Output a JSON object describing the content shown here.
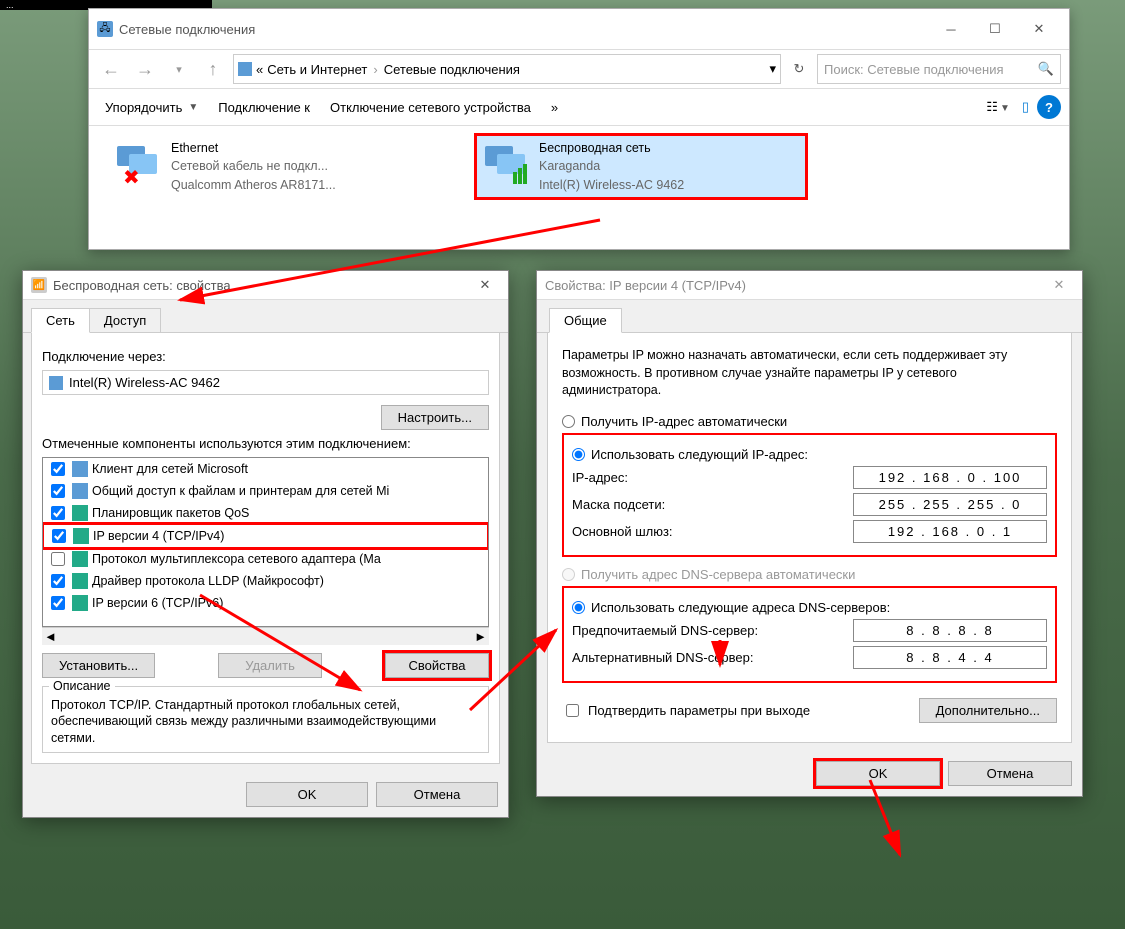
{
  "explorer": {
    "title": "Сетевые подключения",
    "breadcrumb": {
      "pre": "«",
      "a": "Сеть и Интернет",
      "b": "Сетевые подключения"
    },
    "search_placeholder": "Поиск: Сетевые подключения",
    "toolbar": {
      "organize": "Упорядочить",
      "connect": "Подключение к",
      "disable": "Отключение сетевого устройства",
      "more": "»"
    },
    "conns": [
      {
        "name": "Ethernet",
        "line2": "Сетевой кабель не подкл...",
        "line3": "Qualcomm Atheros AR8171..."
      },
      {
        "name": "Беспроводная сеть",
        "line2": "Karaganda",
        "line3": "Intel(R) Wireless-AC 9462"
      }
    ]
  },
  "props": {
    "title": "Беспроводная сеть: свойства",
    "tabs": {
      "net": "Сеть",
      "access": "Доступ"
    },
    "conn_via": "Подключение через:",
    "adapter": "Intel(R) Wireless-AC 9462",
    "configure": "Настроить...",
    "components_label": "Отмеченные компоненты используются этим подключением:",
    "items": [
      {
        "c": true,
        "t": "Клиент для сетей Microsoft"
      },
      {
        "c": true,
        "t": "Общий доступ к файлам и принтерам для сетей Mi"
      },
      {
        "c": true,
        "t": "Планировщик пакетов QoS"
      },
      {
        "c": true,
        "t": "IP версии 4 (TCP/IPv4)"
      },
      {
        "c": false,
        "t": "Протокол мультиплексора сетевого адаптера (Ма"
      },
      {
        "c": true,
        "t": "Драйвер протокола LLDP (Майкрософт)"
      },
      {
        "c": true,
        "t": "IP версии 6 (TCP/IPv6)"
      }
    ],
    "btn_install": "Установить...",
    "btn_remove": "Удалить",
    "btn_props": "Свойства",
    "desc_title": "Описание",
    "desc": "Протокол TCP/IP. Стандартный протокол глобальных сетей, обеспечивающий связь между различными взаимодействующими сетями.",
    "ok": "OK",
    "cancel": "Отмена"
  },
  "ipv4": {
    "title": "Свойства: IP версии 4 (TCP/IPv4)",
    "tab": "Общие",
    "intro": "Параметры IP можно назначать автоматически, если сеть поддерживает эту возможность. В противном случае узнайте параметры IP у сетевого администратора.",
    "r_auto_ip": "Получить IP-адрес автоматически",
    "r_use_ip": "Использовать следующий IP-адрес:",
    "lbl_ip": "IP-адрес:",
    "val_ip": "192 . 168 .   0  . 100",
    "lbl_mask": "Маска подсети:",
    "val_mask": "255 . 255 . 255 .   0",
    "lbl_gw": "Основной шлюз:",
    "val_gw": "192 . 168 .   0  .   1",
    "r_auto_dns": "Получить адрес DNS-сервера автоматически",
    "r_use_dns": "Использовать следующие адреса DNS-серверов:",
    "lbl_dns1": "Предпочитаемый DNS-сервер:",
    "val_dns1": "8  .  8  .  8  .  8",
    "lbl_dns2": "Альтернативный DNS-сервер:",
    "val_dns2": "8  .  8  .  4  .  4",
    "confirm": "Подтвердить параметры при выходе",
    "advanced": "Дополнительно...",
    "ok": "OK",
    "cancel": "Отмена"
  }
}
